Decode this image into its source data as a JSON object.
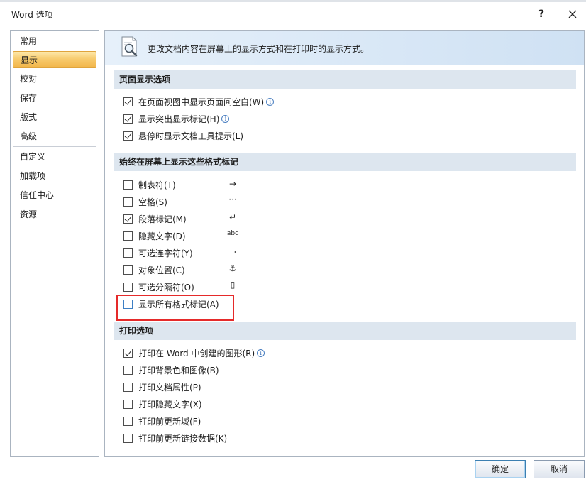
{
  "window": {
    "title": "Word 选项",
    "help_label": "?",
    "close_label": "✕"
  },
  "sidebar": {
    "items": [
      {
        "label": "常用"
      },
      {
        "label": "显示"
      },
      {
        "label": "校对"
      },
      {
        "label": "保存"
      },
      {
        "label": "版式"
      },
      {
        "label": "高级"
      },
      {
        "label": "自定义"
      },
      {
        "label": "加载项"
      },
      {
        "label": "信任中心"
      },
      {
        "label": "资源"
      }
    ],
    "selected": "显示"
  },
  "main": {
    "header_text": "更改文档内容在屏幕上的显示方式和在打印时的显示方式。",
    "sections": {
      "page_display": {
        "title": "页面显示选项",
        "options": [
          {
            "label": "在页面视图中显示页面间空白(W)",
            "checked": true,
            "info": true
          },
          {
            "label": "显示突出显示标记(H)",
            "checked": true,
            "info": true
          },
          {
            "label": "悬停时显示文档工具提示(L)",
            "checked": true,
            "info": false
          }
        ]
      },
      "formatting_marks": {
        "title": "始终在屏幕上显示这些格式标记",
        "options": [
          {
            "label": "制表符(T)",
            "checked": false,
            "mark": "→"
          },
          {
            "label": "空格(S)",
            "checked": false,
            "mark": "···"
          },
          {
            "label": "段落标记(M)",
            "checked": true,
            "mark": "↵"
          },
          {
            "label": "隐藏文字(D)",
            "checked": false,
            "mark": "abc"
          },
          {
            "label": "可选连字符(Y)",
            "checked": false,
            "mark": "¬"
          },
          {
            "label": "对象位置(C)",
            "checked": false,
            "mark": "⚓"
          },
          {
            "label": "可选分隔符(O)",
            "checked": false,
            "mark": "▯"
          },
          {
            "label": "显示所有格式标记(A)",
            "checked": false,
            "mark": ""
          }
        ]
      },
      "print": {
        "title": "打印选项",
        "options": [
          {
            "label": "打印在 Word 中创建的图形(R)",
            "checked": true,
            "info": true
          },
          {
            "label": "打印背景色和图像(B)",
            "checked": false,
            "info": false
          },
          {
            "label": "打印文档属性(P)",
            "checked": false,
            "info": false
          },
          {
            "label": "打印隐藏文字(X)",
            "checked": false,
            "info": false
          },
          {
            "label": "打印前更新域(F)",
            "checked": false,
            "info": false
          },
          {
            "label": "打印前更新链接数据(K)",
            "checked": false,
            "info": false
          }
        ]
      }
    }
  },
  "buttons": {
    "ok": "确定",
    "cancel": "取消"
  },
  "info_glyph": "i",
  "colors": {
    "selected_item": "#f7c96a",
    "section_band": "#dde6ef",
    "highlight_box": "#e52a2a"
  }
}
